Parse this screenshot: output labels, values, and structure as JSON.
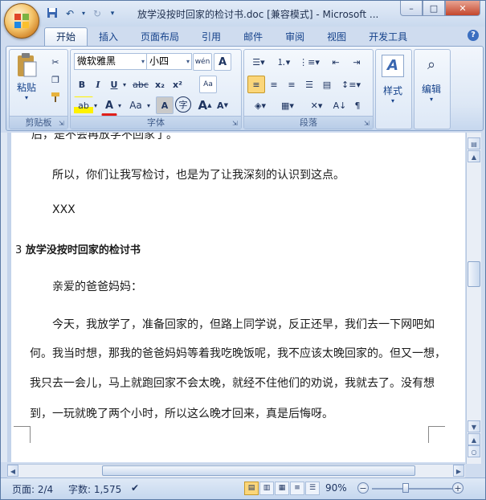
{
  "window": {
    "title": "放学没按时回家的检讨书.doc [兼容模式] - Microsoft ...",
    "controls": {
      "minimize": "–",
      "restore": "□",
      "close": "✕"
    }
  },
  "tabs": [
    "开始",
    "插入",
    "页面布局",
    "引用",
    "邮件",
    "审阅",
    "视图",
    "开发工具"
  ],
  "active_tab": "开始",
  "ribbon": {
    "clipboard": {
      "label": "剪贴板",
      "paste": "粘贴"
    },
    "font": {
      "label": "字体",
      "font_name": "微软雅黑",
      "font_size": "小四",
      "wen": "wén",
      "A": "A",
      "B": "B",
      "I": "I",
      "U": "U",
      "abc": "abc",
      "sub": "x₂",
      "sup": "x²",
      "clear": "Aa",
      "Aa": "Aa",
      "A_box": "A",
      "zi": "字",
      "grow": "A",
      "shrink": "A"
    },
    "paragraph": {
      "label": "段落"
    },
    "styles": {
      "label": "样式"
    },
    "editing": {
      "label": "编辑"
    }
  },
  "document": {
    "line_top_partial": "后，是不会再放学不回家了。",
    "p1": "所以，你们让我写检讨，也是为了让我深刻的认识到这点。",
    "p2": "XXX",
    "heading_num": "3",
    "heading": "放学没按时回家的检讨书",
    "greeting": "亲爱的爸爸妈妈：",
    "body_lines": [
      "今天，我放学了，准备回家的，但路上同学说，反正还早，我们去一下网吧如",
      "何。我当时想，那我的爸爸妈妈等着我吃晚饭呢，我不应该太晚回家的。但又一想，",
      "我只去一会儿，马上就跑回家不会太晚，就经不住他们的劝说，我就去了。没有想",
      "到，一玩就晚了两个小时，所以这么晚才回来，真是后悔呀。"
    ]
  },
  "status": {
    "page": "页面: 2/4",
    "words": "字数: 1,575",
    "zoom": "90%",
    "zoom_level_percent": 90
  }
}
